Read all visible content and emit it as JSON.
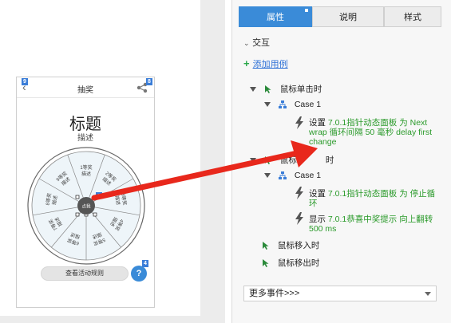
{
  "canvas": {
    "phone": {
      "header_title": "抽奖",
      "badge_back": "9",
      "badge_share": "8",
      "title": "标题",
      "subtitle": "描述",
      "wheel": {
        "segments": [
          "1等奖 描述",
          "2等奖 描述",
          "3等奖 描述",
          "4等奖 描述",
          "5等奖 描述",
          "6等奖 描述",
          "7等奖 描述",
          "8等奖 描述",
          "9等奖 描述"
        ],
        "center_label": "点我",
        "center_badge": "3"
      },
      "rules_button": "查看活动规则",
      "help_button": "?",
      "help_badge": "4"
    }
  },
  "panel": {
    "tabs": [
      {
        "label": "属性",
        "active": true
      },
      {
        "label": "说明",
        "active": false
      },
      {
        "label": "样式",
        "active": false
      }
    ],
    "section": "交互",
    "add_case": "添加用例",
    "events": [
      {
        "name": "鼠标单击时"
      },
      {
        "name": "鼠标移入时"
      },
      {
        "name": "鼠标移出时"
      }
    ],
    "case1_label": "Case 1",
    "case1_action": {
      "verb": "设置 ",
      "target": "7.0.1指针动态面板 为 Next wrap 循环间隔 50 毫秒 delay first change"
    },
    "hidden_event_fragment": "鼠标",
    "case2_label": "Case 1",
    "case2_actions": [
      {
        "verb": "设置 ",
        "target": "7.0.1指针动态面板 为 停止循环"
      },
      {
        "verb": "显示 ",
        "target": "7.0.1恭喜中奖提示 向上翻转 500 ms"
      }
    ],
    "more_events": "更多事件>>>"
  },
  "colors": {
    "accent": "#3a8bd8",
    "action_green": "#2a9a2a",
    "arrow_red": "#e8281c"
  }
}
